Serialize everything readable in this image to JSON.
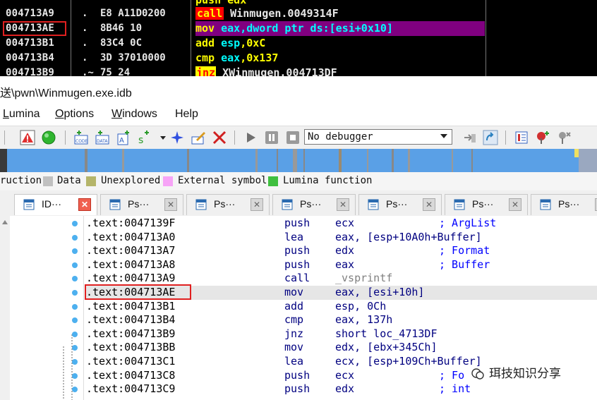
{
  "debugger": {
    "rows": [
      {
        "addr": "004713A9",
        "dot": ".",
        "hex": "E8 A11D0200",
        "mnemonic": "call",
        "operands": "Winmugen.0049314F",
        "style": "call"
      },
      {
        "addr": "004713AE",
        "dot": ".",
        "hex": "8B46 10",
        "mnemonic": "mov",
        "operands_reg": "eax",
        "operands_rest": ",dword ptr ds:[esi+0x10]",
        "style": "highlight"
      },
      {
        "addr": "004713B1",
        "dot": ".",
        "hex": "83C4 0C",
        "mnemonic": "add",
        "operands_reg": "esp",
        "operands_rest": ",0xC",
        "style": "yellow"
      },
      {
        "addr": "004713B4",
        "dot": ".",
        "hex": "3D 37010000",
        "mnemonic": "cmp",
        "operands_reg": "eax",
        "operands_rest": ",0x137",
        "style": "yellow"
      },
      {
        "addr": "004713B9",
        "dot": ".~",
        "hex": "75 24",
        "mnemonic": "jnz",
        "operands": "XWinmugen.004713DF",
        "style": "jnz"
      }
    ],
    "top_partial": "push edx"
  },
  "window_title": "送\\pwn\\Winmugen.exe.idb",
  "menu": [
    {
      "label": "Lumina",
      "underline": "L",
      "rest": "umina"
    },
    {
      "label": "Options",
      "underline": "O",
      "rest": "ptions"
    },
    {
      "label": "Windows",
      "underline": "W",
      "rest": "indows"
    },
    {
      "label": "Help",
      "underline": "",
      "rest": "Help"
    }
  ],
  "toolbar": {
    "debugger_select_value": "No debugger",
    "icons": [
      "warning-icon",
      "green-circle-icon",
      "add-code-icon",
      "add-data-icon",
      "add-ascii-icon",
      "add-struct-icon",
      "star-icon",
      "rename-icon",
      "delete-icon",
      "play-icon",
      "pause-icon",
      "stop-icon",
      "attach-icon",
      "step-icon",
      "breakpoint-list-icon",
      "add-breakpoint-icon",
      "tools-icon"
    ]
  },
  "legend": [
    {
      "label": "ruction",
      "color": ""
    },
    {
      "label": "Data",
      "color": "#c0c0c0"
    },
    {
      "label": "Unexplored",
      "color": "#b5b56a"
    },
    {
      "label": "External symbol",
      "color": "#f7a4f7"
    },
    {
      "label": "Lumina function",
      "color": "#3fbf3f"
    }
  ],
  "tabs": [
    {
      "label": "ID···",
      "active": true
    },
    {
      "label": "Ps···",
      "active": false
    },
    {
      "label": "Ps···",
      "active": false
    },
    {
      "label": "Ps···",
      "active": false
    },
    {
      "label": "Ps···",
      "active": false
    },
    {
      "label": "Ps···",
      "active": false
    },
    {
      "label": "Ps···",
      "active": false
    }
  ],
  "listing": [
    {
      "addr": ".text:0047139F",
      "mn": "push",
      "op": "ecx",
      "cm": "; ArgList",
      "dot": true
    },
    {
      "addr": ".text:004713A0",
      "mn": "lea",
      "op": "eax, [esp+10A0h+Buffer]",
      "cm": "",
      "dot": true
    },
    {
      "addr": ".text:004713A7",
      "mn": "push",
      "op": "edx",
      "cm": "; Format",
      "dot": true
    },
    {
      "addr": ".text:004713A8",
      "mn": "push",
      "op": "eax",
      "cm": "; Buffer",
      "dot": true
    },
    {
      "addr": ".text:004713A9",
      "mn": "call",
      "op": "_vsprintf",
      "cm": "",
      "dot": true
    },
    {
      "addr": ".text:004713AE",
      "mn": "mov",
      "op": "eax, [esi+10h]",
      "cm": "",
      "dot": true,
      "selected": true
    },
    {
      "addr": ".text:004713B1",
      "mn": "add",
      "op": "esp, 0Ch",
      "cm": "",
      "dot": true
    },
    {
      "addr": ".text:004713B4",
      "mn": "cmp",
      "op": "eax, 137h",
      "cm": "",
      "dot": true
    },
    {
      "addr": ".text:004713B9",
      "mn": "jnz",
      "op": "short loc_4713DF",
      "cm": "",
      "dot": true
    },
    {
      "addr": ".text:004713BB",
      "mn": "mov",
      "op": "edx, [ebx+345Ch]",
      "cm": "",
      "dot": true
    },
    {
      "addr": ".text:004713C1",
      "mn": "lea",
      "op": "ecx, [esp+109Ch+Buffer]",
      "cm": "",
      "dot": true
    },
    {
      "addr": ".text:004713C8",
      "mn": "push",
      "op": "ecx",
      "cm": "; Fo",
      "dot": true
    },
    {
      "addr": ".text:004713C9",
      "mn": "push",
      "op": "edx",
      "cm": "; int",
      "dot": true
    }
  ],
  "watermark": "珥技知识分享"
}
